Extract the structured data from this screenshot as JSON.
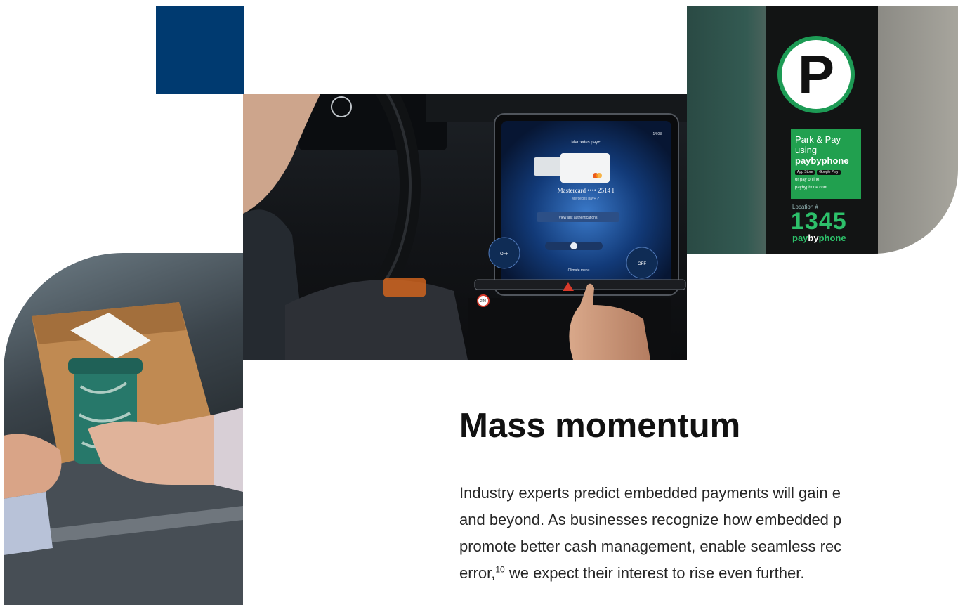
{
  "colors": {
    "accent_navy": "#003a70",
    "parking_green": "#21a04f",
    "heading_text": "#111111",
    "body_text": "#262626"
  },
  "images": {
    "dashboard": {
      "screen_title": "Mercedes pay+",
      "card_label": "Mastercard •••• 2514 I",
      "card_sublabel": "Mercedes pay+ ✓",
      "button_label": "View last authentications",
      "climate_label": "Climate menu",
      "off_left": "OFF",
      "off_right": "OFF",
      "clock": "14:03",
      "speed_sign": "240"
    },
    "parking_meter": {
      "sign_letter": "P",
      "line1": "Park & Pay",
      "line2": "using",
      "brand": "paybyphone",
      "store_a": "App Store",
      "store_b": "Google Play",
      "pay_online": "or pay online:",
      "site": "paybyphone.com",
      "location_label": "Location #",
      "location_number": "1345",
      "brand_bottom_a": "pay",
      "brand_bottom_b": "by",
      "brand_bottom_c": "phone"
    }
  },
  "heading": "Mass momentum",
  "body": {
    "line1": "Industry experts predict embedded payments will gain e",
    "line2": "and beyond. As businesses recognize how embedded p",
    "line3": "promote better cash management, enable seamless rec",
    "line4_before": "error,",
    "footnote": "10",
    "line4_after": " we expect their interest to rise even further."
  }
}
